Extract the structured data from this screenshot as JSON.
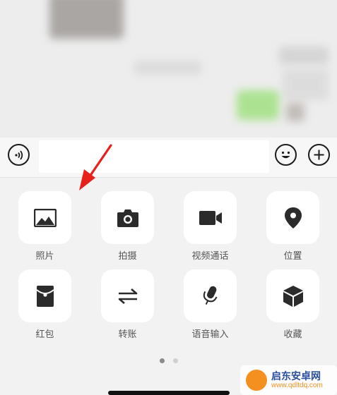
{
  "input_bar": {
    "message_placeholder": ""
  },
  "panel": {
    "items": [
      {
        "label": "照片",
        "icon": "image-icon"
      },
      {
        "label": "拍摄",
        "icon": "camera-icon"
      },
      {
        "label": "视频通话",
        "icon": "video-camera-icon"
      },
      {
        "label": "位置",
        "icon": "location-pin-icon"
      },
      {
        "label": "红包",
        "icon": "red-packet-icon"
      },
      {
        "label": "转账",
        "icon": "transfer-icon"
      },
      {
        "label": "语音输入",
        "icon": "microphone-icon"
      },
      {
        "label": "收藏",
        "icon": "favorites-cube-icon"
      }
    ],
    "page_count": 2,
    "current_page": 1
  },
  "watermark": {
    "title": "启东安卓网",
    "url": "www.qdltdq.com"
  },
  "colors": {
    "accent_arrow": "#e8201b",
    "tile_background": "#ffffff",
    "icon": "#2b2b2b"
  }
}
